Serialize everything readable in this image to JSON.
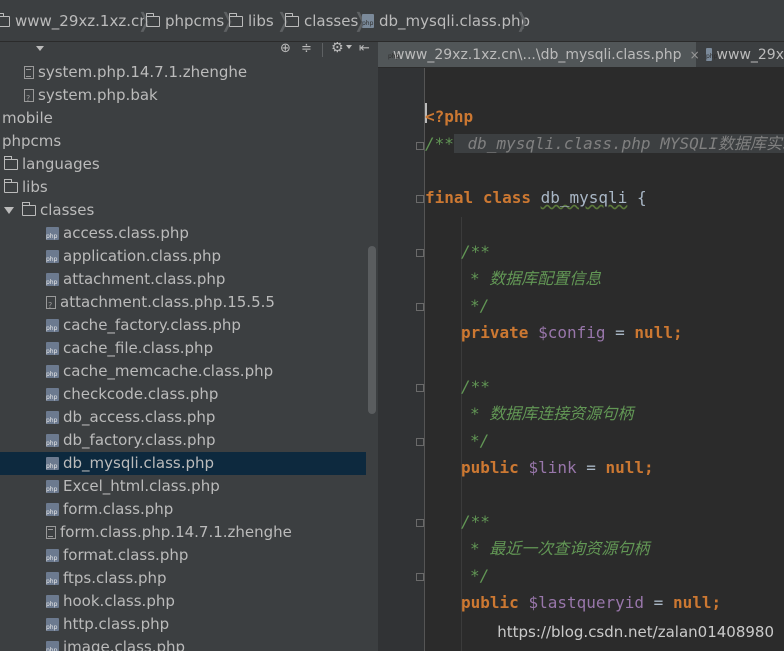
{
  "breadcrumb": [
    {
      "label": "www_29xz.1xz.cn",
      "icon": "folder-icon"
    },
    {
      "label": "phpcms",
      "icon": "folder-icon"
    },
    {
      "label": "libs",
      "icon": "folder-icon"
    },
    {
      "label": "classes",
      "icon": "folder-icon"
    },
    {
      "label": "db_mysqli.class.php",
      "icon": "php-file-icon"
    }
  ],
  "project_toolbar": {
    "dropdown_icon": "chevron-down-icon",
    "icons": [
      "target-icon",
      "collapse-all-icon",
      "gear-icon",
      "hide-panel-icon"
    ]
  },
  "tree": [
    {
      "label": "system.php.14.7.1.zhenghe",
      "type": "doc",
      "indent": 1
    },
    {
      "label": "system.php.bak",
      "type": "txt",
      "indent": 1
    },
    {
      "label": "mobile",
      "type": "none",
      "indent": 0
    },
    {
      "label": "phpcms",
      "type": "none",
      "indent": 0
    },
    {
      "label": "languages",
      "type": "folder",
      "indent": 0
    },
    {
      "label": "libs",
      "type": "folder",
      "indent": 0
    },
    {
      "label": "classes",
      "type": "folder-open",
      "indent": 0
    },
    {
      "label": "access.class.php",
      "type": "php",
      "indent": 2
    },
    {
      "label": "application.class.php",
      "type": "php",
      "indent": 2
    },
    {
      "label": "attachment.class.php",
      "type": "php",
      "indent": 2
    },
    {
      "label": "attachment.class.php.15.5.5",
      "type": "txt",
      "indent": 2
    },
    {
      "label": "cache_factory.class.php",
      "type": "php",
      "indent": 2
    },
    {
      "label": "cache_file.class.php",
      "type": "php",
      "indent": 2
    },
    {
      "label": "cache_memcache.class.php",
      "type": "php",
      "indent": 2
    },
    {
      "label": "checkcode.class.php",
      "type": "php",
      "indent": 2
    },
    {
      "label": "db_access.class.php",
      "type": "php",
      "indent": 2
    },
    {
      "label": "db_factory.class.php",
      "type": "php",
      "indent": 2
    },
    {
      "label": "db_mysqli.class.php",
      "type": "php",
      "indent": 2,
      "selected": true
    },
    {
      "label": "Excel_html.class.php",
      "type": "php",
      "indent": 2
    },
    {
      "label": "form.class.php",
      "type": "php",
      "indent": 2
    },
    {
      "label": "form.class.php.14.7.1.zhenghe",
      "type": "doc",
      "indent": 2
    },
    {
      "label": "format.class.php",
      "type": "php",
      "indent": 2
    },
    {
      "label": "ftps.class.php",
      "type": "php",
      "indent": 2
    },
    {
      "label": "hook.class.php",
      "type": "php",
      "indent": 2
    },
    {
      "label": "http.class.php",
      "type": "php",
      "indent": 2
    },
    {
      "label": "image.class.php",
      "type": "php",
      "indent": 2
    }
  ],
  "tabs": [
    {
      "label": "www_29xz.1xz.cn\\...\\db_mysqli.class.php",
      "close": "×",
      "active": true
    },
    {
      "label": "www_29x",
      "close": "",
      "active": false
    }
  ],
  "code": {
    "open_tag": "<?php",
    "doc_open": "/**",
    "doc_collapsed": " db_mysqli.class.php MYSQLI数据库实现",
    "final_kw": "final",
    "class_kw": "class",
    "class_name": "db_mysqli",
    "brace": "{",
    "comment_open": "/**",
    "comment_close": "*/",
    "comment_config": "* 数据库配置信息",
    "comment_link": "* 数据库连接资源句柄",
    "comment_last": "* 最近一次查询资源句柄",
    "private_kw": "private",
    "public_kw": "public",
    "var_config": "$config",
    "var_link": "$link",
    "var_lastqueryid": "$lastqueryid",
    "assign": " = ",
    "null_kw": "null",
    "semicolon": ";"
  },
  "watermark": "https://blog.csdn.net/zalan01408980",
  "colors": {
    "keyword": "#cc7832",
    "variable": "#9876aa",
    "doc_comment": "#629755",
    "selection": "#0d293e"
  }
}
